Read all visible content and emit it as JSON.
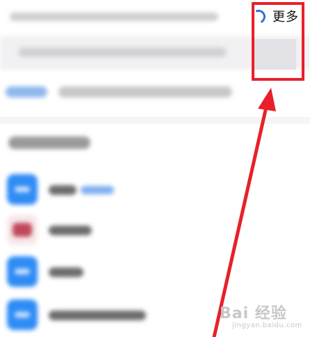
{
  "header": {
    "title": "",
    "more_label": "更多"
  },
  "search": {
    "value": ""
  },
  "watermark": {
    "brand": "Bai 经验",
    "url": "jingyan.baidu.com"
  },
  "colors": {
    "accent_blue": "#2f8cf5",
    "annotation_red": "#e8202a"
  },
  "icons": {
    "loading": "loading-spinner-icon",
    "app": "app-icon"
  }
}
